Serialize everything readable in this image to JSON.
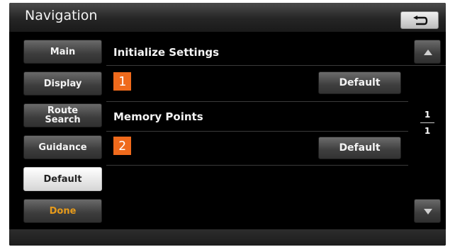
{
  "header": {
    "title": "Navigation"
  },
  "menu": {
    "items": [
      {
        "label": "Main"
      },
      {
        "label": "Display"
      },
      {
        "label": "Route Search"
      },
      {
        "label": "Guidance"
      },
      {
        "label": "Default"
      },
      {
        "label": "Done"
      }
    ],
    "selected": "Default"
  },
  "settings": [
    {
      "label": "Initialize Settings",
      "badge": "1",
      "button": "Default"
    },
    {
      "label": "Memory Points",
      "badge": "2",
      "button": "Default"
    }
  ],
  "pager": {
    "current": "1",
    "total": "1"
  },
  "colors": {
    "badge": "#ef6a1c",
    "done_text": "#e79b1b",
    "background": "#000000"
  },
  "icons": {
    "back": "back-arrow-icon",
    "up": "triangle-up-icon",
    "down": "triangle-down-icon"
  }
}
